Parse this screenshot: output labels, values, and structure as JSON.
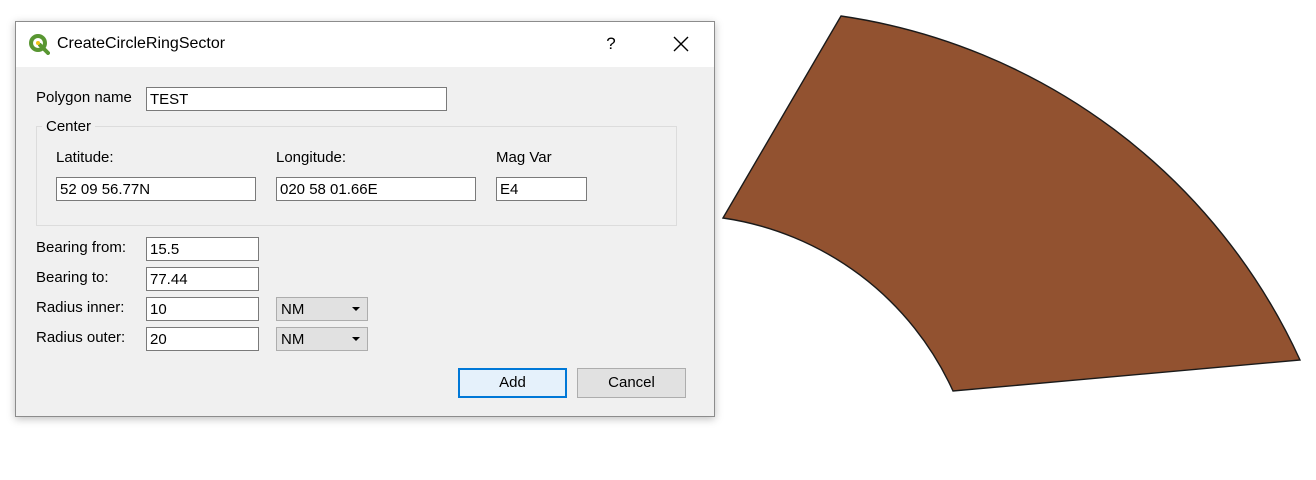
{
  "window": {
    "title": "CreateCircleRingSector",
    "help_label": "?",
    "icons": {
      "app": "qgis-logo-icon",
      "close": "close-icon"
    }
  },
  "form": {
    "polygon_name": {
      "label": "Polygon name",
      "value": "TEST"
    },
    "center": {
      "title": "Center",
      "latitude": {
        "label": "Latitude:",
        "value": "52 09 56.77N"
      },
      "longitude": {
        "label": "Longitude:",
        "value": "020 58 01.66E"
      },
      "mag_var": {
        "label": "Mag Var",
        "value": "E4"
      }
    },
    "bearing_from": {
      "label": "Bearing from:",
      "value": "15.5"
    },
    "bearing_to": {
      "label": "Bearing to:",
      "value": "77.44"
    },
    "radius_inner": {
      "label": "Radius inner:",
      "value": "10",
      "unit": "NM"
    },
    "radius_outer": {
      "label": "Radius outer:",
      "value": "20",
      "unit": "NM"
    }
  },
  "buttons": {
    "add": "Add",
    "cancel": "Cancel"
  },
  "colors": {
    "sector_fill": "#925230",
    "sector_stroke": "#1a1a1a",
    "accent": "#0078d7",
    "qgis_green": "#589632"
  }
}
